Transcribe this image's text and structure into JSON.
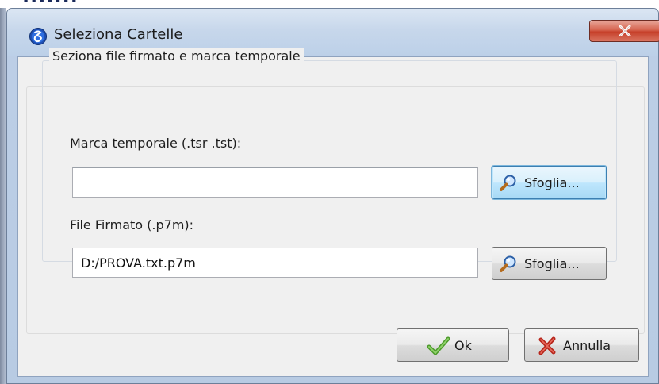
{
  "window": {
    "title": "Seleziona Cartelle",
    "close_symbol": "×"
  },
  "group": {
    "title": "Seziona file firmato e marca temporale"
  },
  "timestamp_field": {
    "label": "Marca temporale (.tsr .tst):",
    "value": "",
    "browse_label": "Sfoglia..."
  },
  "signed_file_field": {
    "label": "File Firmato (.p7m):",
    "value": "D:/PROVA.txt.p7m",
    "browse_label": "Sfoglia..."
  },
  "footer": {
    "ok_label": "Ok",
    "cancel_label": "Annulla"
  },
  "icons": {
    "app": "app-logo-icon",
    "browse": "magnifier-icon",
    "ok": "checkmark-icon",
    "cancel": "x-mark-icon"
  },
  "colors": {
    "title_bar": "#c7d7eb",
    "close_button": "#c6402a",
    "focused_button": "#bee6fd",
    "client_background": "#f0f0f0"
  }
}
